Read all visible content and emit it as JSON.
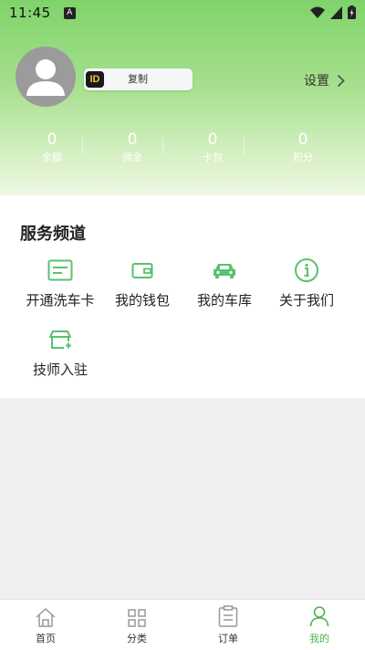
{
  "status_bar": {
    "time": "11:45",
    "notif_icon": "A"
  },
  "profile": {
    "id_badge": "ID",
    "copy_label": "复制",
    "settings_label": "设置"
  },
  "stats": [
    {
      "value": "0",
      "label": "余额"
    },
    {
      "value": "0",
      "label": "佣金"
    },
    {
      "value": "0",
      "label": "卡包"
    },
    {
      "value": "0",
      "label": "积分"
    }
  ],
  "services": {
    "title": "服务频道",
    "items": [
      {
        "label": "开通洗车卡",
        "icon": "card-icon"
      },
      {
        "label": "我的钱包",
        "icon": "wallet-icon"
      },
      {
        "label": "我的车库",
        "icon": "car-icon"
      },
      {
        "label": "关于我们",
        "icon": "info-icon"
      },
      {
        "label": "技师入驻",
        "icon": "technician-icon"
      }
    ]
  },
  "tabbar": {
    "tabs": [
      {
        "label": "首页",
        "icon": "home-icon"
      },
      {
        "label": "分类",
        "icon": "category-icon"
      },
      {
        "label": "订单",
        "icon": "order-icon"
      },
      {
        "label": "我的",
        "icon": "profile-icon",
        "active": true
      }
    ]
  },
  "colors": {
    "accent": "#4fb34f",
    "icon_green": "#58c26e",
    "header_top": "#7fd36a"
  }
}
